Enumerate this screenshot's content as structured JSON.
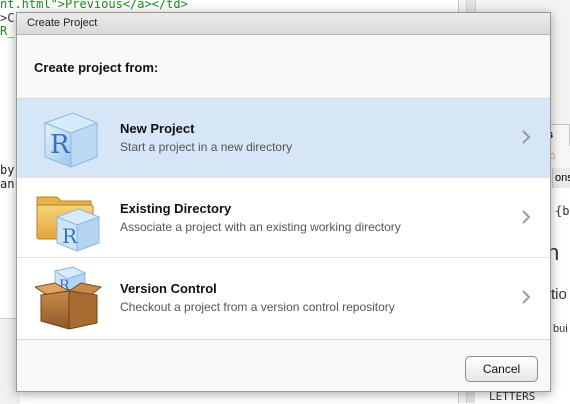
{
  "background": {
    "code_lines": [
      {
        "text": "nt.html\">Previous</a></td>",
        "color": "#1a8c1a"
      },
      {
        "text": ">C",
        "color": "#333333"
      },
      {
        "text": "R_",
        "color": "#1a8c1a"
      },
      {
        "text": " i",
        "color": "#222222"
      },
      {
        "text": "by",
        "color": "#222222"
      },
      {
        "text": "an",
        "color": "#222222"
      }
    ],
    "tab_label": "s",
    "home_glyph": "⌂",
    "const_label": "onst",
    "help_fragments": [
      "{ba",
      "n",
      "tio",
      "bui",
      "LETTERS"
    ]
  },
  "dialog": {
    "title": "Create Project",
    "heading": "Create project from:",
    "options": [
      {
        "title": "New Project",
        "subtitle": "Start a project in a new directory",
        "selected": true
      },
      {
        "title": "Existing Directory",
        "subtitle": "Associate a project with an existing working directory",
        "selected": false
      },
      {
        "title": "Version Control",
        "subtitle": "Checkout a project from a version control repository",
        "selected": false
      }
    ],
    "cancel_label": "Cancel",
    "icon_letter": "R"
  },
  "colors": {
    "selected_row": "#d6e6f7",
    "r_blue": "#3a6fc0"
  }
}
